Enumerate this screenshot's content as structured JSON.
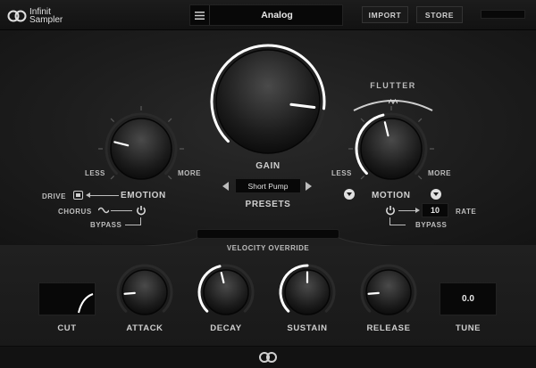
{
  "brand": {
    "line1": "Infinit",
    "line2": "Sampler"
  },
  "header": {
    "menu_icon": "hamburger-icon",
    "preset_name": "Analog",
    "import_label": "IMPORT",
    "store_label": "STORE"
  },
  "gain": {
    "label": "GAIN",
    "value": 0.86
  },
  "emotion": {
    "label": "EMOTION",
    "less": "LESS",
    "more": "MORE",
    "drive": "DRIVE",
    "chorus": "CHORUS",
    "bypass": "BYPASS",
    "value": 0.22
  },
  "presets": {
    "label": "PRESETS",
    "selected": "Short Pump"
  },
  "motion": {
    "label": "MOTION",
    "flutter": "FLUTTER",
    "less": "LESS",
    "more": "MORE",
    "rate_label": "RATE",
    "rate_value": "10",
    "bypass": "BYPASS",
    "value": 0.45
  },
  "velocity": {
    "label": "VELOCITY OVERRIDE"
  },
  "envelope": {
    "cut": {
      "label": "CUT"
    },
    "attack": {
      "label": "ATTACK",
      "value": 0.15
    },
    "decay": {
      "label": "DECAY",
      "value": 0.45
    },
    "sustain": {
      "label": "SUSTAIN",
      "value": 0.5
    },
    "release": {
      "label": "RELEASE",
      "value": 0.15
    },
    "tune": {
      "label": "TUNE",
      "value": "0.0"
    }
  },
  "colors": {
    "accent": "#ffffff",
    "background": "#141414"
  }
}
